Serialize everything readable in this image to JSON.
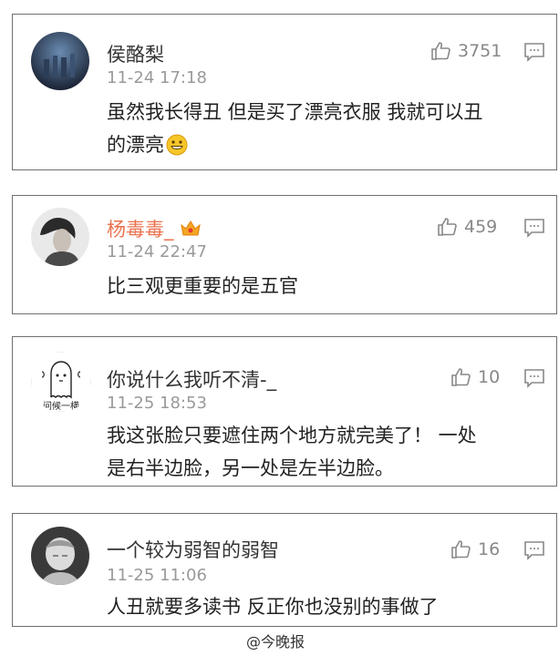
{
  "colors": {
    "border": "#6f6f6f",
    "vip_name": "#eb7350",
    "meta": "#9a9a9a",
    "text": "#222222"
  },
  "comments": [
    {
      "user": "侯酪梨",
      "time": "11-24 17:18",
      "likes": "3751",
      "lines": [
        "虽然我长得丑 但是买了漂亮衣服 我就可以丑",
        "的漂亮"
      ],
      "emoji": "smile-emoji"
    },
    {
      "user": "杨毒毒_",
      "time": "11-24 22:47",
      "likes": "459",
      "lines": [
        "比三观更重要的是五官"
      ],
      "badge": "crown-badge-icon"
    },
    {
      "user": "你说什么我听不清-_",
      "time": "11-25 18:53",
      "likes": "10",
      "lines": [
        "我这张脸只要遮住两个地方就完美了！ 一处",
        "是右半边脸，另一处是左半边脸。"
      ],
      "avatar_caption": "问候一横"
    },
    {
      "user": "一个较为弱智的弱智",
      "time": "11-25 11:06",
      "likes": "16",
      "lines": [
        "人丑就要多读书 反正你也没别的事做了"
      ]
    }
  ],
  "watermark": "@今晚报"
}
